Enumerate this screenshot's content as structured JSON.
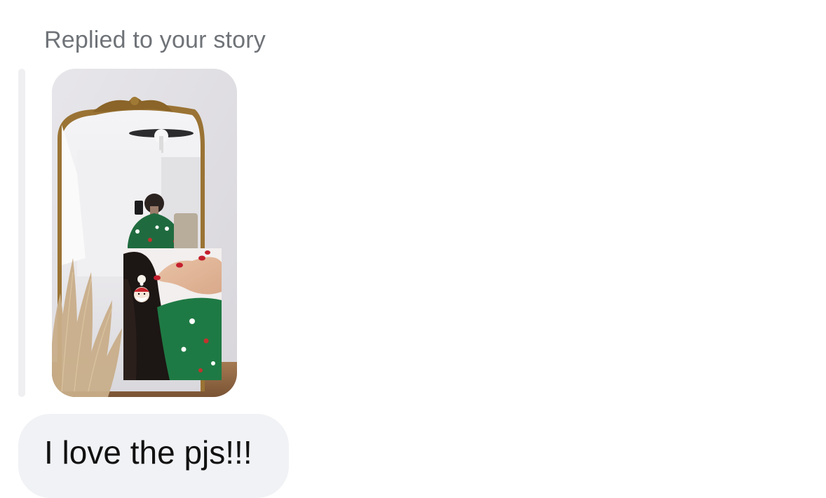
{
  "reply": {
    "label": "Replied to your story"
  },
  "story": {
    "thumbnail_icon": "story-image"
  },
  "message": {
    "text": "I love the pjs!!!"
  }
}
